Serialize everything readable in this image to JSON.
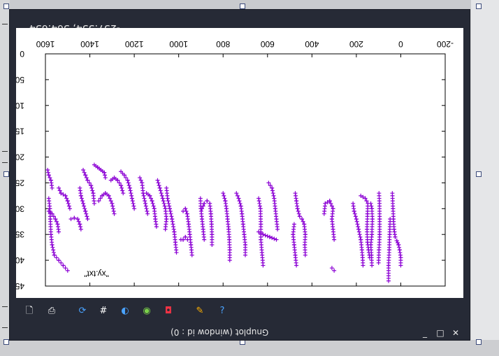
{
  "window": {
    "title": "Gnuplot (window id : 0)",
    "coordinate_readout": "-257.554, 364.634",
    "controls": {
      "minimize": "_",
      "maximize": "□",
      "close": "✕"
    }
  },
  "toolbar": {
    "icons": [
      "copy-to-clipboard-icon",
      "print-icon",
      "replot-icon",
      "grid-icon",
      "zoom-previous-icon",
      "zoom-next-icon",
      "autoscale-icon",
      "options-icon",
      "help-icon"
    ]
  },
  "colors": {
    "window_bg": "#262a36",
    "plot_points": "#8b00d4",
    "plot_bg": "#ffffff",
    "text": "#e8e8e8"
  },
  "chart_data": {
    "type": "scatter",
    "orientation": "rotated-180",
    "legend": "\"xy.txt\"",
    "x_ticks": [
      "-200",
      "0",
      "200",
      "400",
      "600",
      "800",
      "1000",
      "1200",
      "1400",
      "1600"
    ],
    "y_ticks": [
      "0",
      "50",
      "100",
      "150",
      "200",
      "250",
      "300",
      "350",
      "400",
      "450"
    ],
    "xlim": [
      -200,
      1600
    ],
    "ylim": [
      0,
      450
    ],
    "series": [
      {
        "marker": "+",
        "strokes": [
          [
            [
              0,
              410
            ],
            [
              0,
              395
            ],
            [
              5,
              380
            ],
            [
              10,
              370
            ],
            [
              18,
              362
            ],
            [
              25,
              355
            ],
            [
              30,
              340
            ],
            [
              33,
              320
            ],
            [
              35,
              300
            ],
            [
              38,
              270
            ]
          ],
          [
            [
              55,
              440
            ],
            [
              55,
              410
            ],
            [
              52,
              380
            ],
            [
              50,
              350
            ],
            [
              48,
              320
            ]
          ],
          [
            [
              100,
              405
            ],
            [
              98,
              380
            ],
            [
              95,
              350
            ],
            [
              95,
              320
            ],
            [
              96,
              290
            ],
            [
              98,
              270
            ]
          ],
          [
            [
              130,
              410
            ],
            [
              132,
              390
            ],
            [
              135,
              370
            ],
            [
              130,
              350
            ],
            [
              128,
              320
            ],
            [
              130,
              300
            ],
            [
              135,
              290
            ]
          ],
          [
            [
              140,
              395
            ],
            [
              145,
              380
            ],
            [
              150,
              365
            ],
            [
              152,
              340
            ],
            [
              150,
              310
            ],
            [
              148,
              290
            ],
            [
              160,
              280
            ],
            [
              180,
              275
            ]
          ],
          [
            [
              170,
              410
            ],
            [
              172,
              395
            ],
            [
              175,
              380
            ],
            [
              180,
              360
            ],
            [
              190,
              340
            ],
            [
              200,
              320
            ],
            [
              210,
              305
            ],
            [
              215,
              290
            ]
          ],
          [
            [
              300,
              360
            ],
            [
              305,
              340
            ],
            [
              310,
              320
            ],
            [
              305,
              300
            ],
            [
              320,
              285
            ],
            [
              340,
              290
            ],
            [
              345,
              310
            ]
          ],
          [
            [
              300,
              420
            ],
            [
              310,
              415
            ]
          ],
          [
            [
              430,
              390
            ],
            [
              432,
              370
            ],
            [
              430,
              350
            ],
            [
              435,
              330
            ],
            [
              445,
              320
            ],
            [
              455,
              315
            ],
            [
              465,
              300
            ],
            [
              470,
              285
            ],
            [
              475,
              270
            ]
          ],
          [
            [
              470,
              410
            ],
            [
              475,
              390
            ],
            [
              480,
              370
            ],
            [
              485,
              350
            ],
            [
              480,
              330
            ]
          ],
          [
            [
              555,
              340
            ],
            [
              560,
              320
            ],
            [
              565,
              300
            ],
            [
              570,
              280
            ],
            [
              580,
              260
            ],
            [
              595,
              250
            ]
          ],
          [
            [
              560,
              360
            ],
            [
              590,
              355
            ],
            [
              620,
              350
            ],
            [
              640,
              345
            ]
          ],
          [
            [
              620,
              410
            ],
            [
              625,
              385
            ],
            [
              630,
              360
            ],
            [
              630,
              330
            ],
            [
              632,
              300
            ],
            [
              640,
              280
            ]
          ],
          [
            [
              700,
              390
            ],
            [
              700,
              370
            ],
            [
              705,
              350
            ],
            [
              710,
              330
            ],
            [
              715,
              310
            ],
            [
              720,
              295
            ],
            [
              730,
              280
            ],
            [
              740,
              270
            ]
          ],
          [
            [
              770,
              400
            ],
            [
              770,
              380
            ],
            [
              772,
              360
            ],
            [
              775,
              340
            ],
            [
              780,
              320
            ],
            [
              785,
              300
            ],
            [
              790,
              285
            ],
            [
              800,
              270
            ]
          ],
          [
            [
              850,
              370
            ],
            [
              850,
              350
            ],
            [
              852,
              330
            ],
            [
              855,
              310
            ],
            [
              860,
              290
            ],
            [
              872,
              285
            ],
            [
              885,
              290
            ],
            [
              895,
              300
            ]
          ],
          [
            [
              885,
              360
            ],
            [
              890,
              340
            ],
            [
              895,
              320
            ],
            [
              900,
              300
            ],
            [
              902,
              280
            ]
          ],
          [
            [
              940,
              390
            ],
            [
              945,
              370
            ],
            [
              950,
              350
            ],
            [
              955,
              330
            ],
            [
              962,
              310
            ],
            [
              970,
              300
            ],
            [
              980,
              305
            ]
          ],
          [
            [
              960,
              360
            ],
            [
              970,
              355
            ],
            [
              980,
              360
            ],
            [
              990,
              360
            ]
          ],
          [
            [
              1010,
              385
            ],
            [
              1015,
              365
            ],
            [
              1020,
              345
            ],
            [
              1030,
              320
            ],
            [
              1040,
              300
            ],
            [
              1050,
              280
            ],
            [
              1055,
              260
            ]
          ],
          [
            [
              1060,
              340
            ],
            [
              1055,
              320
            ],
            [
              1060,
              300
            ],
            [
              1072,
              280
            ],
            [
              1085,
              260
            ],
            [
              1095,
              245
            ]
          ],
          [
            [
              1100,
              335
            ],
            [
              1105,
              320
            ],
            [
              1110,
              300
            ],
            [
              1120,
              285
            ],
            [
              1130,
              275
            ],
            [
              1145,
              270
            ]
          ],
          [
            [
              1140,
              310
            ],
            [
              1150,
              290
            ],
            [
              1160,
              270
            ],
            [
              1165,
              250
            ],
            [
              1175,
              240
            ]
          ],
          [
            [
              1200,
              300
            ],
            [
              1210,
              280
            ],
            [
              1220,
              260
            ],
            [
              1230,
              245
            ],
            [
              1245,
              235
            ],
            [
              1260,
              228
            ]
          ],
          [
            [
              1250,
              270
            ],
            [
              1260,
              255
            ],
            [
              1275,
              245
            ],
            [
              1290,
              240
            ],
            [
              1305,
              245
            ]
          ],
          [
            [
              1290,
              310
            ],
            [
              1300,
              290
            ],
            [
              1315,
              275
            ],
            [
              1330,
              270
            ],
            [
              1345,
              275
            ],
            [
              1360,
              285
            ]
          ],
          [
            [
              1330,
              240
            ],
            [
              1335,
              230
            ],
            [
              1350,
              225
            ],
            [
              1365,
              220
            ],
            [
              1380,
              215
            ]
          ],
          [
            [
              1380,
              290
            ],
            [
              1385,
              270
            ],
            [
              1395,
              255
            ],
            [
              1410,
              245
            ],
            [
              1420,
              235
            ],
            [
              1430,
              225
            ]
          ],
          [
            [
              1410,
              320
            ],
            [
              1420,
              305
            ],
            [
              1430,
              290
            ],
            [
              1440,
              275
            ],
            [
              1445,
              260
            ]
          ],
          [
            [
              1440,
              340
            ],
            [
              1445,
              330
            ],
            [
              1455,
              320
            ],
            [
              1470,
              318
            ],
            [
              1485,
              320
            ]
          ],
          [
            [
              1490,
              300
            ],
            [
              1500,
              285
            ],
            [
              1510,
              275
            ],
            [
              1530,
              270
            ],
            [
              1540,
              260
            ]
          ],
          [
            [
              1500,
              420
            ],
            [
              1520,
              410
            ],
            [
              1540,
              400
            ],
            [
              1560,
              390
            ],
            [
              1570,
              370
            ],
            [
              1575,
              350
            ],
            [
              1578,
              320
            ],
            [
              1580,
              300
            ],
            [
              1585,
              280
            ]
          ],
          [
            [
              1540,
              345
            ],
            [
              1545,
              330
            ],
            [
              1555,
              320
            ],
            [
              1570,
              310
            ],
            [
              1585,
              305
            ]
          ],
          [
            [
              1570,
              260
            ],
            [
              1575,
              245
            ],
            [
              1585,
              235
            ],
            [
              1590,
              225
            ]
          ]
        ]
      }
    ]
  }
}
